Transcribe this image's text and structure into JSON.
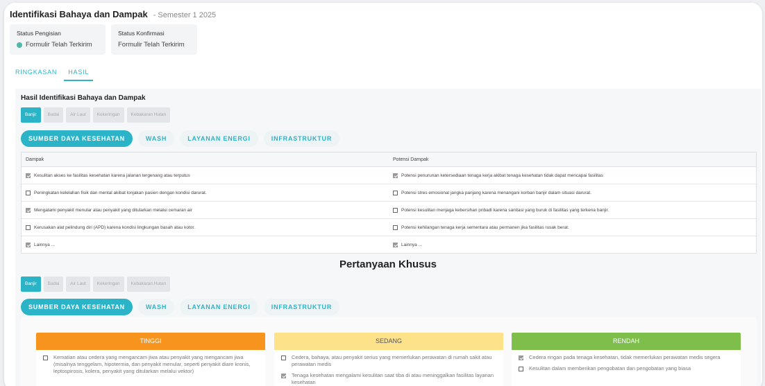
{
  "header": {
    "title": "Identifikasi Bahaya dan Dampak",
    "subtitle": "- Semester 1 2025"
  },
  "status": {
    "filling_label": "Status Pengisian",
    "filling_value": "Formulir Telah Terkirim",
    "confirm_label": "Status Konfirmasi",
    "confirm_value": "Formulir Telah Terkirim",
    "dot_color": "#4fb8a8"
  },
  "tabs": [
    {
      "label": "RINGKASAN",
      "active": false
    },
    {
      "label": "HASIL",
      "active": true
    }
  ],
  "section_title": "Hasil Identifikasi Bahaya dan Dampak",
  "hazards": [
    {
      "label": "Banjir",
      "active": true
    },
    {
      "label": "Badai",
      "active": false
    },
    {
      "label": "Air Laut",
      "active": false
    },
    {
      "label": "Kekeringan",
      "active": false
    },
    {
      "label": "Kebakaran Hutan",
      "active": false
    }
  ],
  "categories": [
    {
      "label": "SUMBER DAYA KESEHATAN",
      "active": true
    },
    {
      "label": "WASH",
      "active": false
    },
    {
      "label": "LAYANAN ENERGI",
      "active": false
    },
    {
      "label": "INFRASTRUKTUR",
      "active": false
    }
  ],
  "table": {
    "columns": [
      "Dampak",
      "Potensi Dampak"
    ],
    "rows": [
      {
        "impact": "Kesulitan akses ke fasilitas kesehatan karena jalanan tergenang atau terputus",
        "impact_checked": true,
        "potential": "Potensi penurunan ketersediaan tenaga kerja akibat tenaga kesehatan tidak dapat mencapai fasilitas",
        "potential_checked": true
      },
      {
        "impact": "Peningkatan kelelahan fisik dan mental akibat lonjakan pasien dengan kondisi darurat.",
        "impact_checked": false,
        "potential": "Potensi stres emosional jangka panjang karena menangani korban banjir dalam situasi darurat.",
        "potential_checked": false
      },
      {
        "impact": "Mengalami penyakit menular atau penyakit yang ditularkan melalui cemaran air",
        "impact_checked": true,
        "potential": "Potensi kesulitan menjaga kebersihan pribadi karena sanitasi yang buruk di fasilitas yang terkena banjir.",
        "potential_checked": false
      },
      {
        "impact": "Kerusakan alat pelindung diri (APD) karena kondisi lingkungan basah atau kotor.",
        "impact_checked": false,
        "potential": "Potensi kehilangan tenaga kerja sementara atau permanen jika fasilitas rusak berat.",
        "potential_checked": false
      },
      {
        "impact": "Lainnya ...",
        "impact_checked": true,
        "potential": "Lainnya ...",
        "potential_checked": true
      }
    ]
  },
  "questions_title": "Pertanyaan Khusus",
  "risk": {
    "high": {
      "label": "TINGGI",
      "color": "#f7941d",
      "items": [
        {
          "text": "Kematian atau cedera yang mengancam jiwa atau penyakit yang mengancam jiwa (misalnya tenggelam, hipotermia, dan penyakit menular, seperti penyakit diare kronis, leptospirosis, kolera, penyakit yang ditularkan melalui vektor)",
          "checked": false
        }
      ]
    },
    "medium": {
      "label": "SEDANG",
      "color": "#fde28a",
      "items": [
        {
          "text": "Cedera, bahaya, atau penyakit serius yang memerlukan perawatan di rumah sakit atau perawatan medis",
          "checked": false
        },
        {
          "text": "Tenaga kesehatan mengalami kesulitan saat tiba di atau meninggalkan fasilitas layanan kesehatan",
          "checked": true
        }
      ]
    },
    "low": {
      "label": "RENDAH",
      "color": "#7dbf4a",
      "items": [
        {
          "text": "Cedera ringan pada tenaga kesehatan, tidak memerlukan perawatan medis segera",
          "checked": true
        },
        {
          "text": "Kesulitan dalam memberikan pengobatan dan pengobatan yang biasa",
          "checked": false
        }
      ]
    }
  },
  "colors": {
    "accent": "#2bb3c7",
    "high": "#f7941d",
    "medium": "#fde28a",
    "low": "#7dbf4a"
  }
}
